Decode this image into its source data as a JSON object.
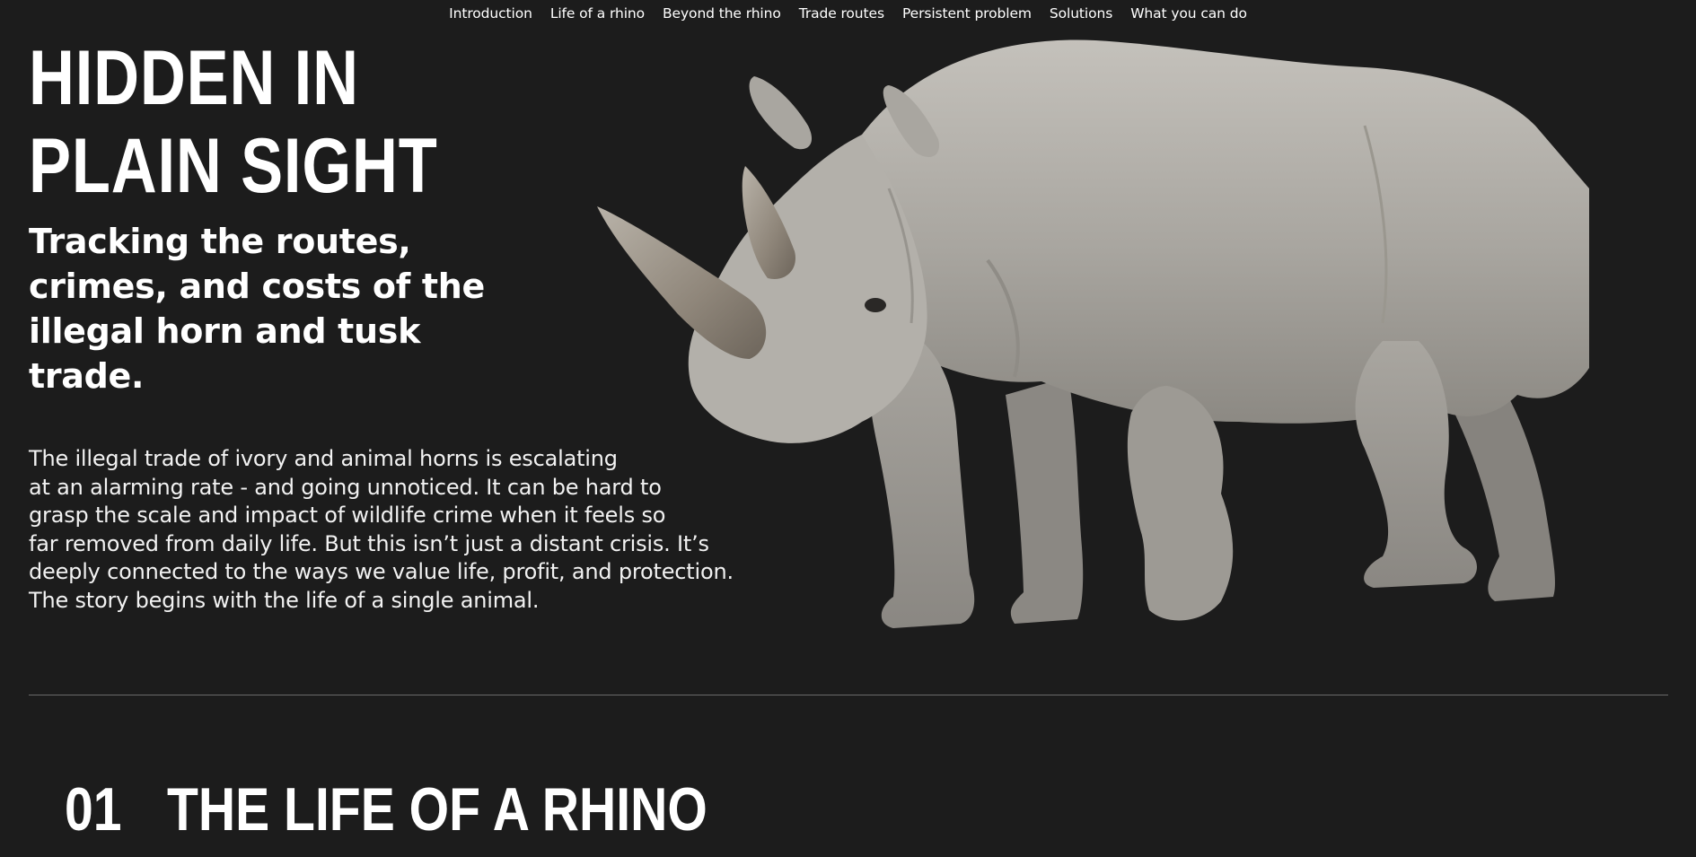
{
  "nav": {
    "items": [
      {
        "label": "Introduction"
      },
      {
        "label": "Life of a rhino"
      },
      {
        "label": "Beyond the rhino"
      },
      {
        "label": "Trade routes"
      },
      {
        "label": "Persistent problem"
      },
      {
        "label": "Solutions"
      },
      {
        "label": "What you can do"
      }
    ]
  },
  "hero": {
    "title_line1": "HIDDEN IN",
    "title_line2": "PLAIN SIGHT",
    "subtitle": "Tracking the routes, crimes, and costs of the illegal horn and tusk trade.",
    "intro_lines": [
      "The illegal trade of ivory and animal horns is escalating",
      "at an alarming rate - and going unnoticed. It can be hard to",
      "grasp the scale and impact of wildlife crime when it feels so",
      "far removed from daily life. But this isn’t just a distant crisis. It’s",
      "deeply connected to the ways we value life, profit, and protection.",
      "The story begins with the life of a single animal."
    ],
    "image": "rhino-photo"
  },
  "section": {
    "number": "01",
    "title": "THE LIFE OF A RHINO"
  },
  "colors": {
    "background": "#1c1c1c",
    "text": "#ffffff",
    "divider": "#6b6b6b",
    "rhino_body": "#a6a39e"
  }
}
